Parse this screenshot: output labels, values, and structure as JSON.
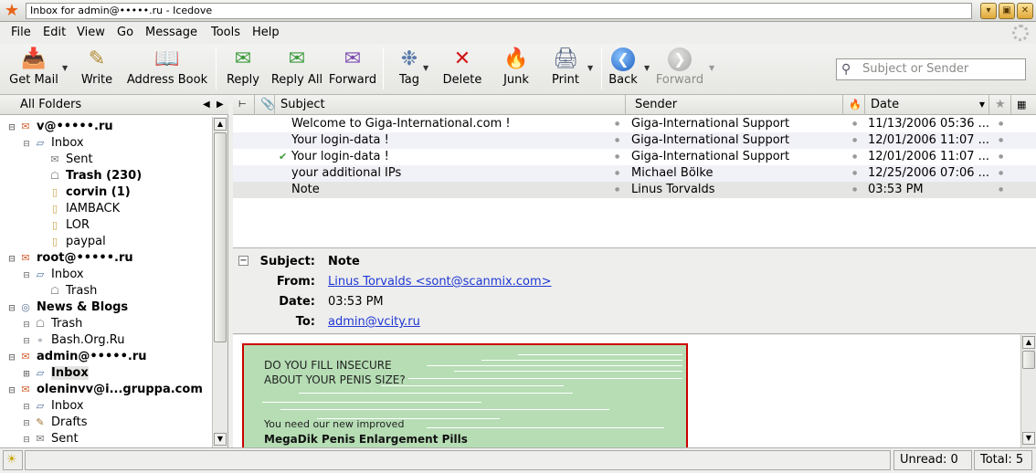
{
  "window": {
    "title": "Inbox for admin@•••••.ru - Icedove"
  },
  "menu": [
    "File",
    "Edit",
    "View",
    "Go",
    "Message",
    "Tools",
    "Help"
  ],
  "toolbar": {
    "get_mail": "Get Mail",
    "write": "Write",
    "address_book": "Address Book",
    "reply": "Reply",
    "reply_all": "Reply All",
    "forward": "Forward",
    "tag": "Tag",
    "delete": "Delete",
    "junk": "Junk",
    "print": "Print",
    "back": "Back",
    "nav_forward": "Forward"
  },
  "search": {
    "placeholder": "Subject or Sender"
  },
  "folders": {
    "header": "All Folders",
    "items": [
      {
        "label": "v@•••••.ru",
        "bold": true,
        "level": 0,
        "icon": "account-icon"
      },
      {
        "label": "Inbox",
        "bold": false,
        "level": 1,
        "icon": "inbox-icon"
      },
      {
        "label": "Sent",
        "bold": false,
        "level": 2,
        "icon": "sent-icon"
      },
      {
        "label": "Trash (230)",
        "bold": true,
        "level": 2,
        "icon": "trash-icon"
      },
      {
        "label": "corvin (1)",
        "bold": true,
        "level": 2,
        "icon": "folder-icon"
      },
      {
        "label": "IAMBACK",
        "bold": false,
        "level": 2,
        "icon": "folder-icon"
      },
      {
        "label": "LOR",
        "bold": false,
        "level": 2,
        "icon": "folder-icon"
      },
      {
        "label": "paypal",
        "bold": false,
        "level": 2,
        "icon": "folder-icon"
      },
      {
        "label": "root@•••••.ru",
        "bold": true,
        "level": 0,
        "icon": "account-icon"
      },
      {
        "label": "Inbox",
        "bold": false,
        "level": 1,
        "icon": "inbox-icon"
      },
      {
        "label": "Trash",
        "bold": false,
        "level": 2,
        "icon": "trash-icon"
      },
      {
        "label": "News & Blogs",
        "bold": true,
        "level": 0,
        "icon": "rss-icon"
      },
      {
        "label": "Trash",
        "bold": false,
        "level": 1,
        "icon": "trash-icon"
      },
      {
        "label": "Bash.Org.Ru",
        "bold": false,
        "level": 1,
        "icon": "feed-icon"
      },
      {
        "label": "admin@•••••.ru",
        "bold": true,
        "level": 0,
        "icon": "account-icon"
      },
      {
        "label": "Inbox",
        "bold": true,
        "level": 1,
        "icon": "inbox-icon",
        "selected": true
      },
      {
        "label": "oleninvv@i...gruppa.com",
        "bold": true,
        "level": 0,
        "icon": "account-icon"
      },
      {
        "label": "Inbox",
        "bold": false,
        "level": 1,
        "icon": "inbox-icon"
      },
      {
        "label": "Drafts",
        "bold": false,
        "level": 1,
        "icon": "drafts-icon"
      },
      {
        "label": "Sent",
        "bold": false,
        "level": 1,
        "icon": "sent-icon"
      }
    ]
  },
  "threads": {
    "columns": {
      "subject": "Subject",
      "sender": "Sender",
      "date": "Date"
    },
    "rows": [
      {
        "subject": "Welcome to Giga-International.com !",
        "sender": "Giga-International Support",
        "date": "11/13/2006 05:36 ...",
        "replied": false
      },
      {
        "subject": "Your login-data !",
        "sender": "Giga-International Support",
        "date": "12/01/2006 11:07 ...",
        "replied": false
      },
      {
        "subject": "Your login-data !",
        "sender": "Giga-International Support",
        "date": "12/01/2006 11:07 ...",
        "replied": true
      },
      {
        "subject": "your additional IPs",
        "sender": "Michael Bölke",
        "date": "12/25/2006 07:06 ...",
        "replied": false
      },
      {
        "subject": "Note",
        "sender": "Linus Torvalds",
        "date": "03:53 PM",
        "replied": false,
        "selected": true
      }
    ]
  },
  "message": {
    "subject_label": "Subject:",
    "subject": "Note",
    "from_label": "From:",
    "from": "Linus Torvalds <sont@scanmix.com>",
    "date_label": "Date:",
    "date": "03:53 PM",
    "to_label": "To:",
    "to": "admin@vcity.ru",
    "body_lines": [
      "DO YOU FILL INSECURE",
      "ABOUT YOUR PENIS SIZE?",
      "You need our new improved",
      "MegaDik Penis Enlargement Pills"
    ]
  },
  "status": {
    "unread": "Unread: 0",
    "total": "Total: 5"
  }
}
